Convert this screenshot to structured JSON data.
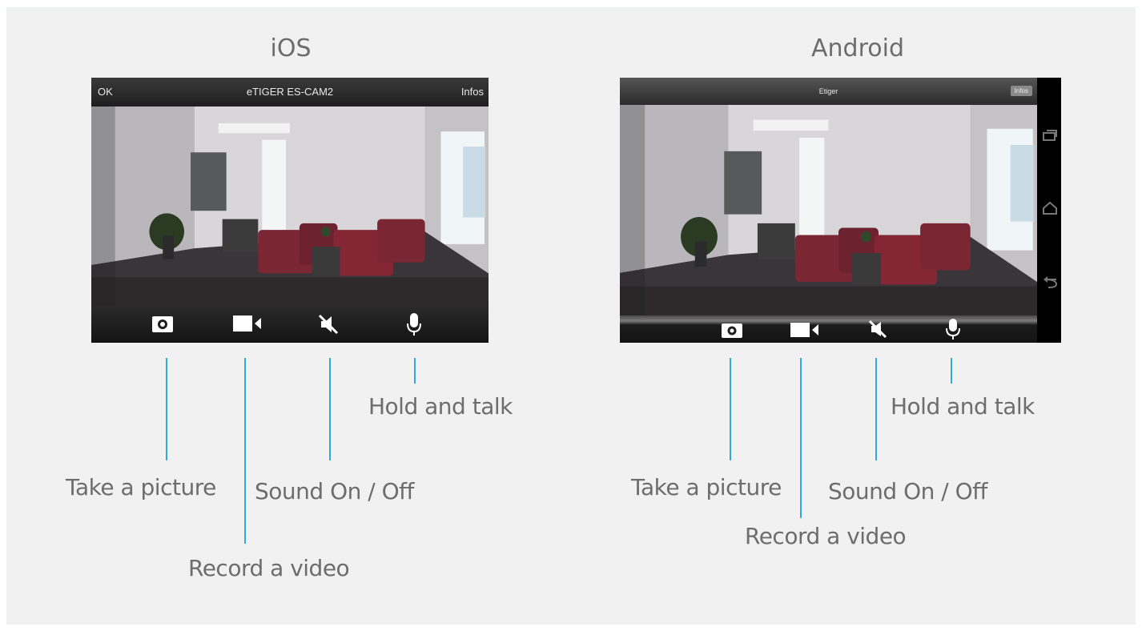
{
  "ios": {
    "heading": "iOS",
    "topbar": {
      "left": "OK",
      "title": "eTIGER ES-CAM2",
      "right": "Infos"
    },
    "labels": {
      "picture": "Take a picture",
      "video": "Record a video",
      "sound": "Sound On / Off",
      "talk": "Hold and talk"
    }
  },
  "android": {
    "heading": "Android",
    "topbar": {
      "title": "Etiger",
      "right": "Infos"
    },
    "labels": {
      "picture": "Take a picture",
      "video": "Record a video",
      "sound": "Sound On / Off",
      "talk": "Hold and talk"
    }
  },
  "controls": [
    "camera-icon",
    "video-camera-icon",
    "mute-icon",
    "microphone-icon"
  ],
  "colors": {
    "accent_line": "#31a9da",
    "text": "#6d6d6d",
    "panel": "#f1f1f1"
  }
}
